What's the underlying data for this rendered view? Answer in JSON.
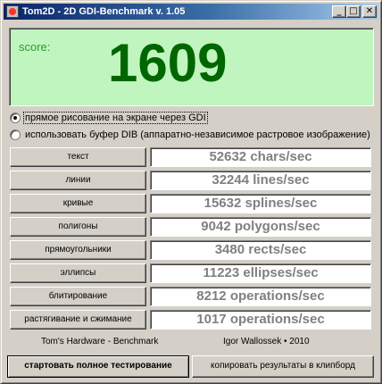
{
  "window": {
    "title": "Tom2D - 2D GDI-Benchmark v. 1.05",
    "minimize_glyph": "_",
    "maximize_glyph": "□",
    "close_glyph": "✕"
  },
  "score": {
    "label": "score:",
    "value": "1609"
  },
  "options": {
    "direct_label": "прямое рисование на экране через GDI",
    "dib_label": "использовать буфер DIB (аппаратно-независимое растровое изображение)",
    "selected": "direct"
  },
  "tests": [
    {
      "label": "текст",
      "result": "52632 chars/sec"
    },
    {
      "label": "линии",
      "result": "32244 lines/sec"
    },
    {
      "label": "кривые",
      "result": "15632 splines/sec"
    },
    {
      "label": "полигоны",
      "result": "9042 polygons/sec"
    },
    {
      "label": "прямоугольники",
      "result": "3480 rects/sec"
    },
    {
      "label": "эллипсы",
      "result": "11223 ellipses/sec"
    },
    {
      "label": "блитирование",
      "result": "8212 operations/sec"
    },
    {
      "label": "растягивание и сжимание",
      "result": "1017 operations/sec"
    }
  ],
  "footer": {
    "credit_left": "Tom's Hardware - Benchmark",
    "credit_right": "Igor Wallossek • 2010",
    "start_button": "стартовать полное тестирование",
    "copy_button": "копировать результаты в клипборд"
  },
  "colors": {
    "score_bg": "#c0f5c0",
    "score_value": "#006600",
    "result_text": "#808080",
    "title_gradient_start": "#0a246a"
  }
}
